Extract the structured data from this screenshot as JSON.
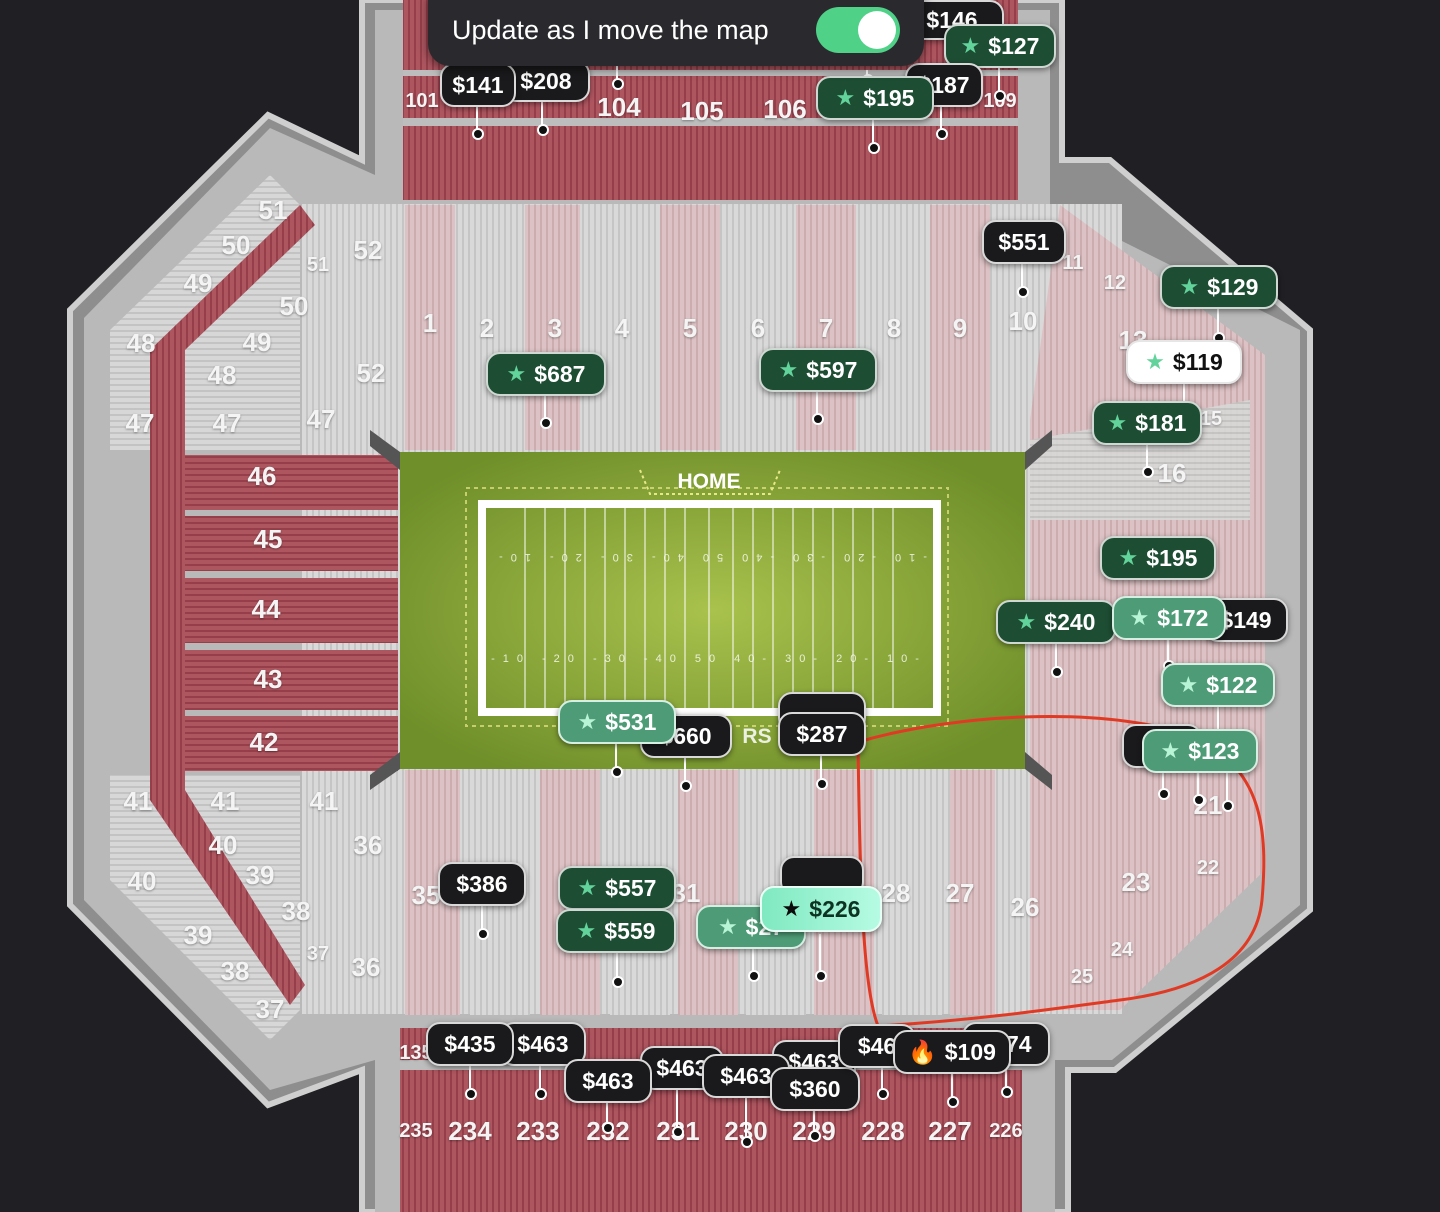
{
  "toggle": {
    "label": "Update as I move the map",
    "on": true
  },
  "field": {
    "endzone_top": "HOME",
    "endzone_bottom": "RS",
    "yard_numbers_top": "-10 -20 -30 -40 50 40- 30- 20- 10-",
    "yard_numbers_bottom": "-10 -20 -30 -40 50 40- 30- 20- 10-"
  },
  "sections": {
    "s1": "1",
    "s2": "2",
    "s3": "3",
    "s4": "4",
    "s5": "5",
    "s6": "6",
    "s7": "7",
    "s8": "8",
    "s9": "9",
    "s10": "10",
    "s11": "11",
    "s12": "12",
    "s13": "13",
    "s15": "15",
    "s16": "16",
    "s21": "21",
    "s22": "22",
    "s23": "23",
    "s24": "24",
    "s25": "25",
    "s26": "26",
    "s27": "27",
    "s28": "28",
    "s31": "31",
    "s35": "35",
    "s36": "36",
    "s36b": "36",
    "s37": "37",
    "s37b": "37",
    "s38": "38",
    "s38b": "38",
    "s39": "39",
    "s39b": "39",
    "s40": "40",
    "s40b": "40",
    "s41": "41",
    "s41b": "41",
    "s41c": "41",
    "s42": "42",
    "s43": "43",
    "s44": "44",
    "s45": "45",
    "s46": "46",
    "s47": "47",
    "s47b": "47",
    "s47c": "47",
    "s48": "48",
    "s48b": "48",
    "s49": "49",
    "s49b": "49",
    "s50": "50",
    "s50b": "50",
    "s51": "51",
    "s51b": "51",
    "s52": "52",
    "s52b": "52",
    "s101": "101",
    "s104": "104",
    "s105": "105",
    "s106": "106",
    "s109": "109",
    "s135": "135",
    "s226": "226",
    "s227": "227",
    "s228": "228",
    "s229": "229",
    "s230": "230",
    "s231": "231",
    "s232": "232",
    "s233": "233",
    "s234": "234",
    "s235": "235"
  },
  "prices": {
    "p146": "$146",
    "p127": "$127",
    "p141": "$141",
    "p208": "$208",
    "p187": "$187",
    "p195a": "$195",
    "p551": "$551",
    "p129": "$129",
    "p119": "$119",
    "p181": "$181",
    "p687": "$687",
    "p597": "$597",
    "p195b": "$195",
    "p240": "$240",
    "p172": "$172",
    "p149": "$149",
    "p122": "$122",
    "p123": "$123",
    "p531": "$531",
    "p660": "$660",
    "p287": "$287",
    "p386": "$386",
    "p557": "$557",
    "p559": "$559",
    "p27x": "$27",
    "p226": "$226",
    "p435": "$435",
    "p463a": "$463",
    "p463b": "$463",
    "p463c": "$463",
    "p463d": "$463",
    "p463e": "$463",
    "p463f": "$46",
    "p360": "$360",
    "p109": "$109",
    "p374": "$374"
  },
  "colors": {
    "maroon": "#a9505a",
    "grass": "#8fb039",
    "chip_dark": "#1a1a1c",
    "chip_green": "#1d4d33",
    "accent_toggle": "#4fd188",
    "annotation": "#e03a25"
  }
}
